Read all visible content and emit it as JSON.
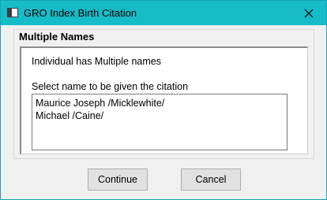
{
  "window": {
    "title": "GRO Index Birth Citation",
    "close_icon": "close-icon",
    "app_icon": "window-icon"
  },
  "group": {
    "title": "Multiple Names",
    "info_text": "Individual has Multiple names",
    "select_label": "Select name to be given the citation",
    "names": [
      "Maurice Joseph /Micklewhite/",
      "Michael /Caine/"
    ]
  },
  "buttons": {
    "continue_label": "Continue",
    "cancel_label": "Cancel"
  },
  "colors": {
    "titlebar": "#17bcc9",
    "window_border": "#14a2b0",
    "background": "#f0f0f0"
  }
}
